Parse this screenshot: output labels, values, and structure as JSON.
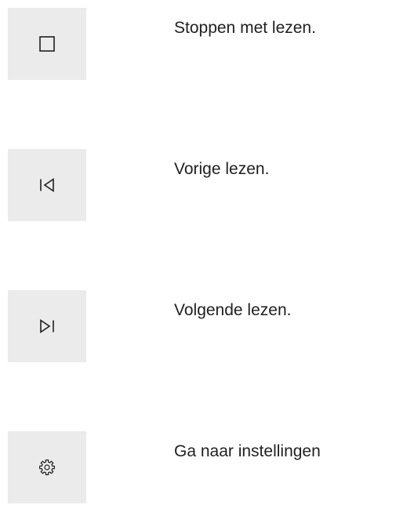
{
  "controls": [
    {
      "icon": "stop-icon",
      "label": "Stoppen met lezen."
    },
    {
      "icon": "skip-previous-icon",
      "label": "Vorige lezen."
    },
    {
      "icon": "skip-next-icon",
      "label": "Volgende lezen."
    },
    {
      "icon": "gear-icon",
      "label": "Ga naar instellingen"
    }
  ],
  "colors": {
    "button_background": "#ebebeb",
    "icon_stroke": "#1f1f1f",
    "text": "#1f1f1f"
  }
}
